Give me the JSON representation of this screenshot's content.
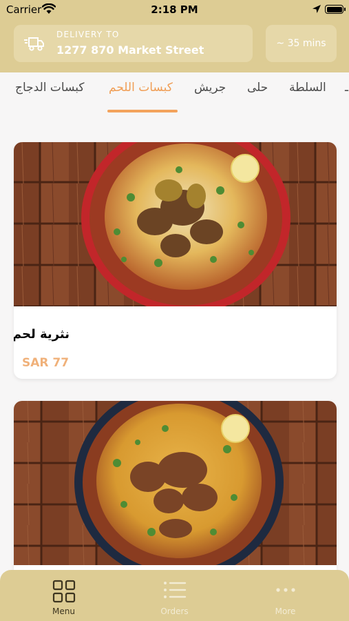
{
  "status_bar": {
    "carrier": "Carrier",
    "time": "2:18 PM"
  },
  "header": {
    "delivery_label": "DELIVERY TO",
    "delivery_address": "1277 870 Market Street",
    "eta": "~ 35 mins"
  },
  "category_tabs": [
    {
      "label": "كبسات الدجاج"
    },
    {
      "label": "كبسات اللحم",
      "active": true
    },
    {
      "label": "جريش"
    },
    {
      "label": "حلى"
    },
    {
      "label": "السلطة"
    }
  ],
  "menu_items": [
    {
      "name": "نثرية لحم",
      "price": "SAR 77"
    },
    {
      "name": "",
      "price": ""
    }
  ],
  "bottom_nav": [
    {
      "label": "Menu",
      "icon": "grid-icon",
      "active": true
    },
    {
      "label": "Orders",
      "icon": "list-icon"
    },
    {
      "label": "More",
      "icon": "more-dots-icon"
    }
  ],
  "colors": {
    "header_bg": "#ddcc94",
    "accent": "#f09d54",
    "price": "#f0b17a",
    "nav_active": "#3d3520",
    "nav_inactive": "#f3ecd4"
  }
}
